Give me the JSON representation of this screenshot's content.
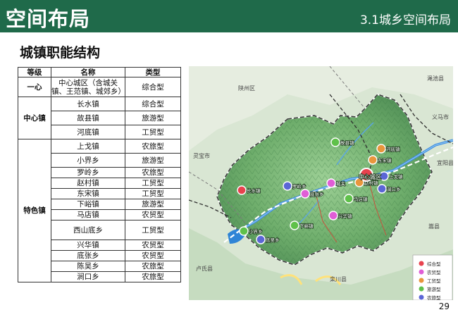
{
  "header": {
    "title": "空间布局",
    "section": "3.1城乡空间布局"
  },
  "subtitle": "城镇职能结构",
  "table": {
    "headers": [
      "等级",
      "名称",
      "类型"
    ],
    "groups": [
      {
        "level": "一心",
        "rows": [
          {
            "name": "中心城区（含城关镇、王范镇、城郊乡）",
            "type": "综合型"
          }
        ]
      },
      {
        "level": "中心镇",
        "rows": [
          {
            "name": "长水镇",
            "type": "综合型"
          },
          {
            "name": "故县镇",
            "type": "旅游型"
          },
          {
            "name": "河底镇",
            "type": "工贸型"
          }
        ]
      },
      {
        "level": "特色镇",
        "rows": [
          {
            "name": "上戈镇",
            "type": "农旅型"
          },
          {
            "name": "小界乡",
            "type": "旅游型"
          },
          {
            "name": "罗岭乡",
            "type": "农旅型"
          },
          {
            "name": "赵村镇",
            "type": "工贸型"
          },
          {
            "name": "东宋镇",
            "type": "工贸型"
          },
          {
            "name": "下峪镇",
            "type": "旅游型"
          },
          {
            "name": "马店镇",
            "type": "农贸型"
          },
          {
            "name": "西山底乡",
            "type": "工贸型"
          },
          {
            "name": "兴华镇",
            "type": "农贸型"
          },
          {
            "name": "底张乡",
            "type": "农贸型"
          },
          {
            "name": "陈吴乡",
            "type": "农旅型"
          },
          {
            "name": "涧口乡",
            "type": "农旅型"
          }
        ]
      }
    ]
  },
  "map": {
    "center_label": "中心城区",
    "towns": [
      {
        "name": "河底镇",
        "type": "gongmao"
      },
      {
        "name": "东宋镇",
        "type": "gongmao"
      },
      {
        "name": "涧口乡",
        "type": "nonglv"
      },
      {
        "name": "赵村镇",
        "type": "gongmao"
      },
      {
        "name": "上戈镇",
        "type": "nonglv"
      },
      {
        "name": "城关",
        "type": "nongmao"
      },
      {
        "name": "底张乡",
        "type": "nongmao"
      },
      {
        "name": "罗岭乡",
        "type": "nonglv"
      },
      {
        "name": "故县镇",
        "type": "lvyou"
      },
      {
        "name": "长水镇",
        "type": "zonghe"
      },
      {
        "name": "兴华镇",
        "type": "nongmao"
      },
      {
        "name": "马店镇",
        "type": "lvyou"
      },
      {
        "name": "下峪镇",
        "type": "lvyou"
      },
      {
        "name": "小界乡",
        "type": "lvyou"
      },
      {
        "name": "陈吴乡",
        "type": "nonglv"
      }
    ],
    "legend": [
      {
        "label": "综合型",
        "color": "#e8424e"
      },
      {
        "label": "农贸型",
        "color": "#e05ed6"
      },
      {
        "label": "工贸型",
        "color": "#e8963c"
      },
      {
        "label": "旅游型",
        "color": "#5fc14a"
      },
      {
        "label": "农旅型",
        "color": "#5b66d6"
      }
    ],
    "place_labels": [
      "陕州区",
      "渑池县",
      "义马市",
      "宜阳县",
      "嵩县",
      "卢氏县",
      "灵宝市",
      "栾川县"
    ]
  },
  "page_number": "29"
}
